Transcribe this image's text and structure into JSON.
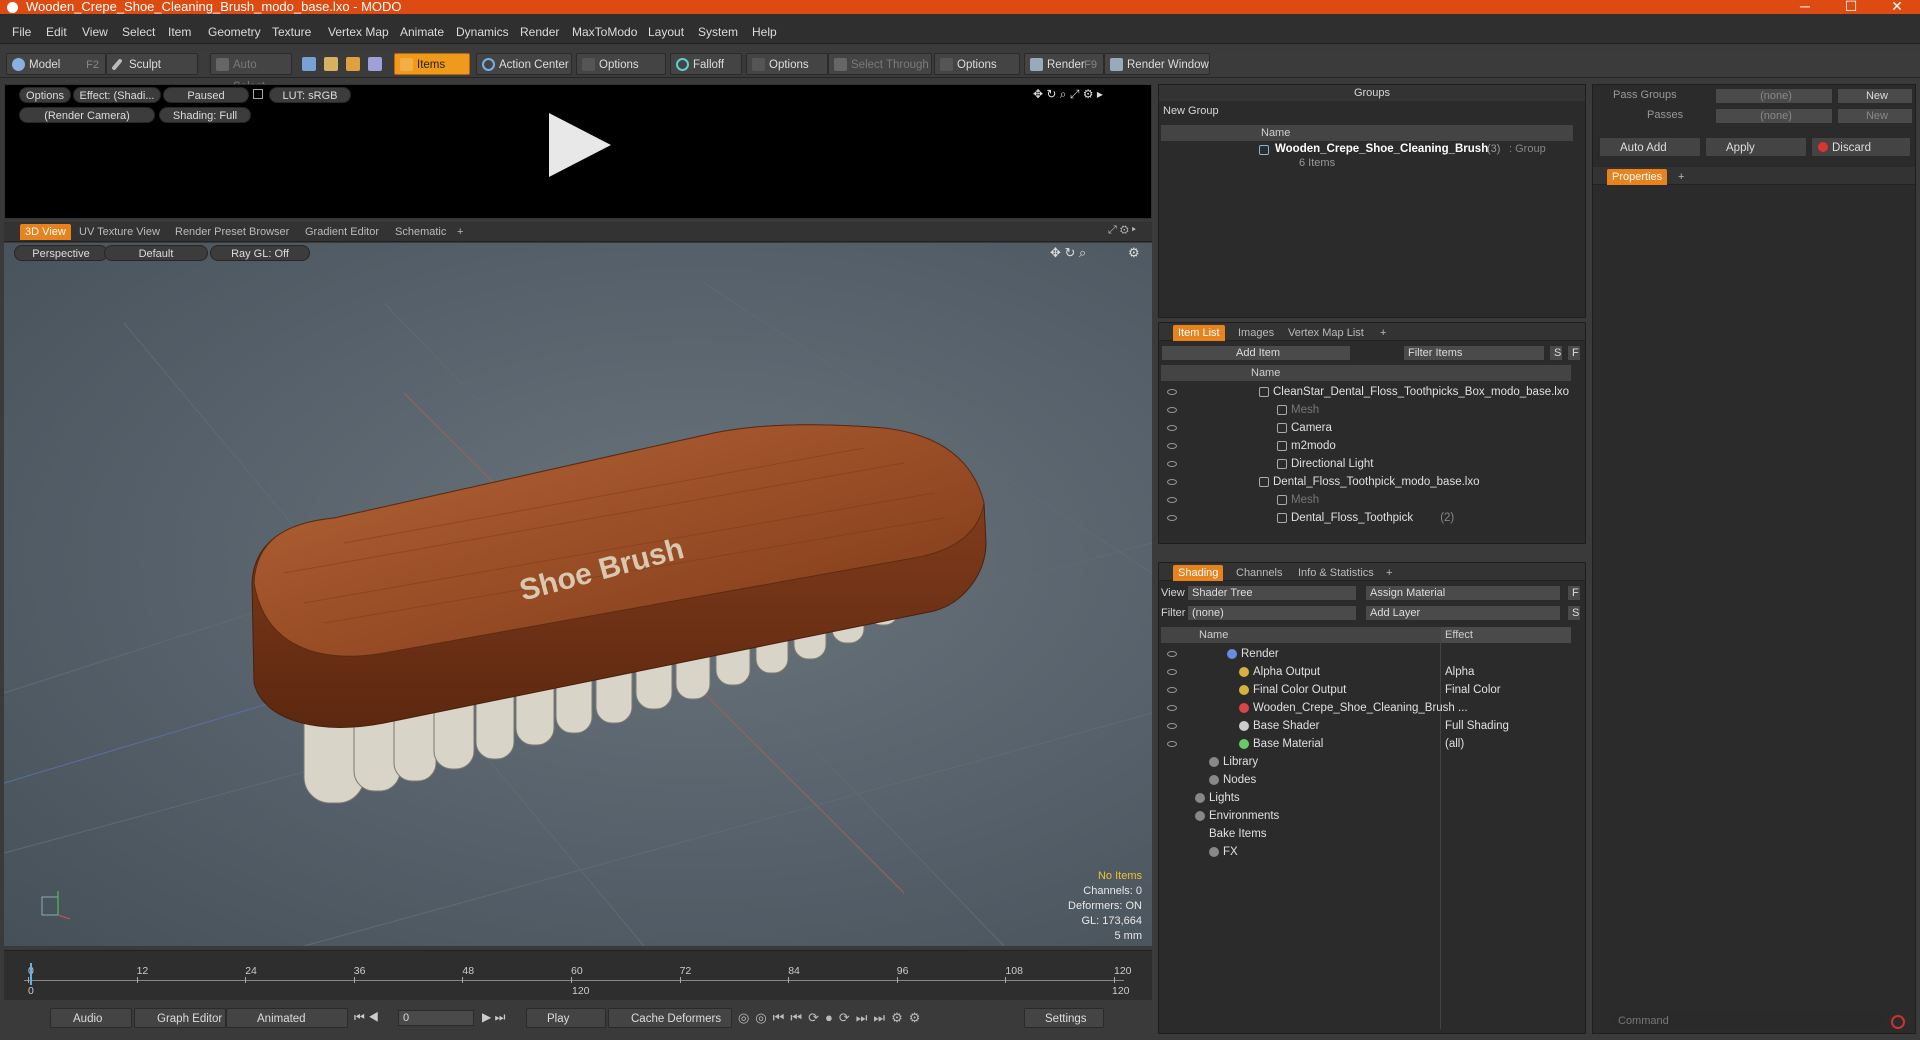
{
  "window": {
    "title": "Wooden_Crepe_Shoe_Cleaning_Brush_modo_base.lxo - MODO",
    "minimize": "─",
    "maximize": "☐",
    "close": "✕"
  },
  "menu": [
    "File",
    "Edit",
    "View",
    "Select",
    "Item",
    "Geometry",
    "Texture",
    "Vertex Map",
    "Animate",
    "Dynamics",
    "Render",
    "MaxToModo",
    "Layout",
    "System",
    "Help"
  ],
  "toolbar": {
    "model": "Model",
    "model_key": "F2",
    "sculpt": "Sculpt",
    "auto_select": "Auto Select",
    "items": "Items",
    "action_center": "Action Center",
    "options1": "Options",
    "falloff": "Falloff",
    "options2": "Options",
    "select_through": "Select Through",
    "options3": "Options",
    "render": "Render",
    "render_key": "F9",
    "render_window": "Render Window"
  },
  "preview": {
    "options": "Options",
    "effect": "Effect: (Shadi...",
    "paused": "Paused",
    "lut": "LUT: sRGB",
    "camera": "(Render Camera)",
    "shading": "Shading: Full"
  },
  "viewport_tabs": [
    "3D View",
    "UV Texture View",
    "Render Preset Browser",
    "Gradient Editor",
    "Schematic",
    "+"
  ],
  "viewport": {
    "perspective": "Perspective",
    "default": "Default",
    "raygl": "Ray GL: Off",
    "brush_label": "Shoe Brush",
    "stats": {
      "no_items": "No Items",
      "channels": "Channels: 0",
      "deformers": "Deformers: ON",
      "gl": "GL: 173,664",
      "scale": "5 mm"
    }
  },
  "timeline": {
    "ticks": [
      "0",
      "12",
      "24",
      "36",
      "48",
      "60",
      "72",
      "84",
      "96",
      "108",
      "120"
    ],
    "sub_ticks": [
      "0",
      "120",
      "120"
    ]
  },
  "bottombar": {
    "audio": "Audio",
    "graph_editor": "Graph Editor",
    "animated": "Animated",
    "frame": "0",
    "play": "Play",
    "cache": "Cache Deformers",
    "settings": "Settings"
  },
  "groups": {
    "title": "Groups",
    "new_group": "New Group",
    "col_name": "Name",
    "row_name": "Wooden_Crepe_Shoe_Cleaning_Brush",
    "row_count": "(3)",
    "row_type": ": Group",
    "row_items": "6 Items"
  },
  "passes": {
    "pass_groups": "Pass Groups",
    "passes": "Passes",
    "none1": "(none)",
    "none2": "(none)",
    "new1": "New",
    "new2": "New",
    "auto_add": "Auto Add",
    "apply": "Apply",
    "discard": "Discard",
    "properties": "Properties",
    "plus": "+",
    "command": "Command"
  },
  "itemlist": {
    "tabs": [
      "Item List",
      "Images",
      "Vertex Map List",
      "+"
    ],
    "add_item": "Add Item",
    "filter": "Filter Items",
    "s": "S",
    "f": "F",
    "col_name": "Name",
    "rows": [
      {
        "label": "CleanStar_Dental_Floss_Toothpicks_Box_modo_base.lxo",
        "extra": ""
      },
      {
        "label": "Mesh",
        "extra": ""
      },
      {
        "label": "Camera",
        "extra": ""
      },
      {
        "label": "m2modo",
        "extra": ""
      },
      {
        "label": "Directional Light",
        "extra": ""
      },
      {
        "label": "Dental_Floss_Toothpick_modo_base.lxo",
        "extra": ""
      },
      {
        "label": "Mesh",
        "extra": ""
      },
      {
        "label": "Dental_Floss_Toothpick",
        "extra": "(2)"
      }
    ]
  },
  "shading": {
    "tabs": [
      "Shading",
      "Channels",
      "Info & Statistics",
      "+"
    ],
    "view_label": "View",
    "view_value": "Shader Tree",
    "assign": "Assign Material",
    "f": "F",
    "filter_label": "Filter",
    "filter_value": "(none)",
    "add_layer": "Add Layer",
    "s": "S",
    "col_name": "Name",
    "col_effect": "Effect",
    "rows": [
      {
        "name": "Render",
        "effect": ""
      },
      {
        "name": "Alpha Output",
        "effect": "Alpha"
      },
      {
        "name": "Final Color Output",
        "effect": "Final Color"
      },
      {
        "name": "Wooden_Crepe_Shoe_Cleaning_Brush ...",
        "effect": ""
      },
      {
        "name": "Base Shader",
        "effect": "Full Shading"
      },
      {
        "name": "Base Material",
        "effect": "(all)"
      },
      {
        "name": "Library",
        "effect": ""
      },
      {
        "name": "Nodes",
        "effect": ""
      },
      {
        "name": "Lights",
        "effect": ""
      },
      {
        "name": "Environments",
        "effect": ""
      },
      {
        "name": "Bake Items",
        "effect": ""
      },
      {
        "name": "FX",
        "effect": ""
      }
    ]
  },
  "colors": {
    "accent": "#e8821c",
    "title_bar": "#dd4a12",
    "wood": "#a0522d",
    "bristle": "#d8d4c8"
  }
}
